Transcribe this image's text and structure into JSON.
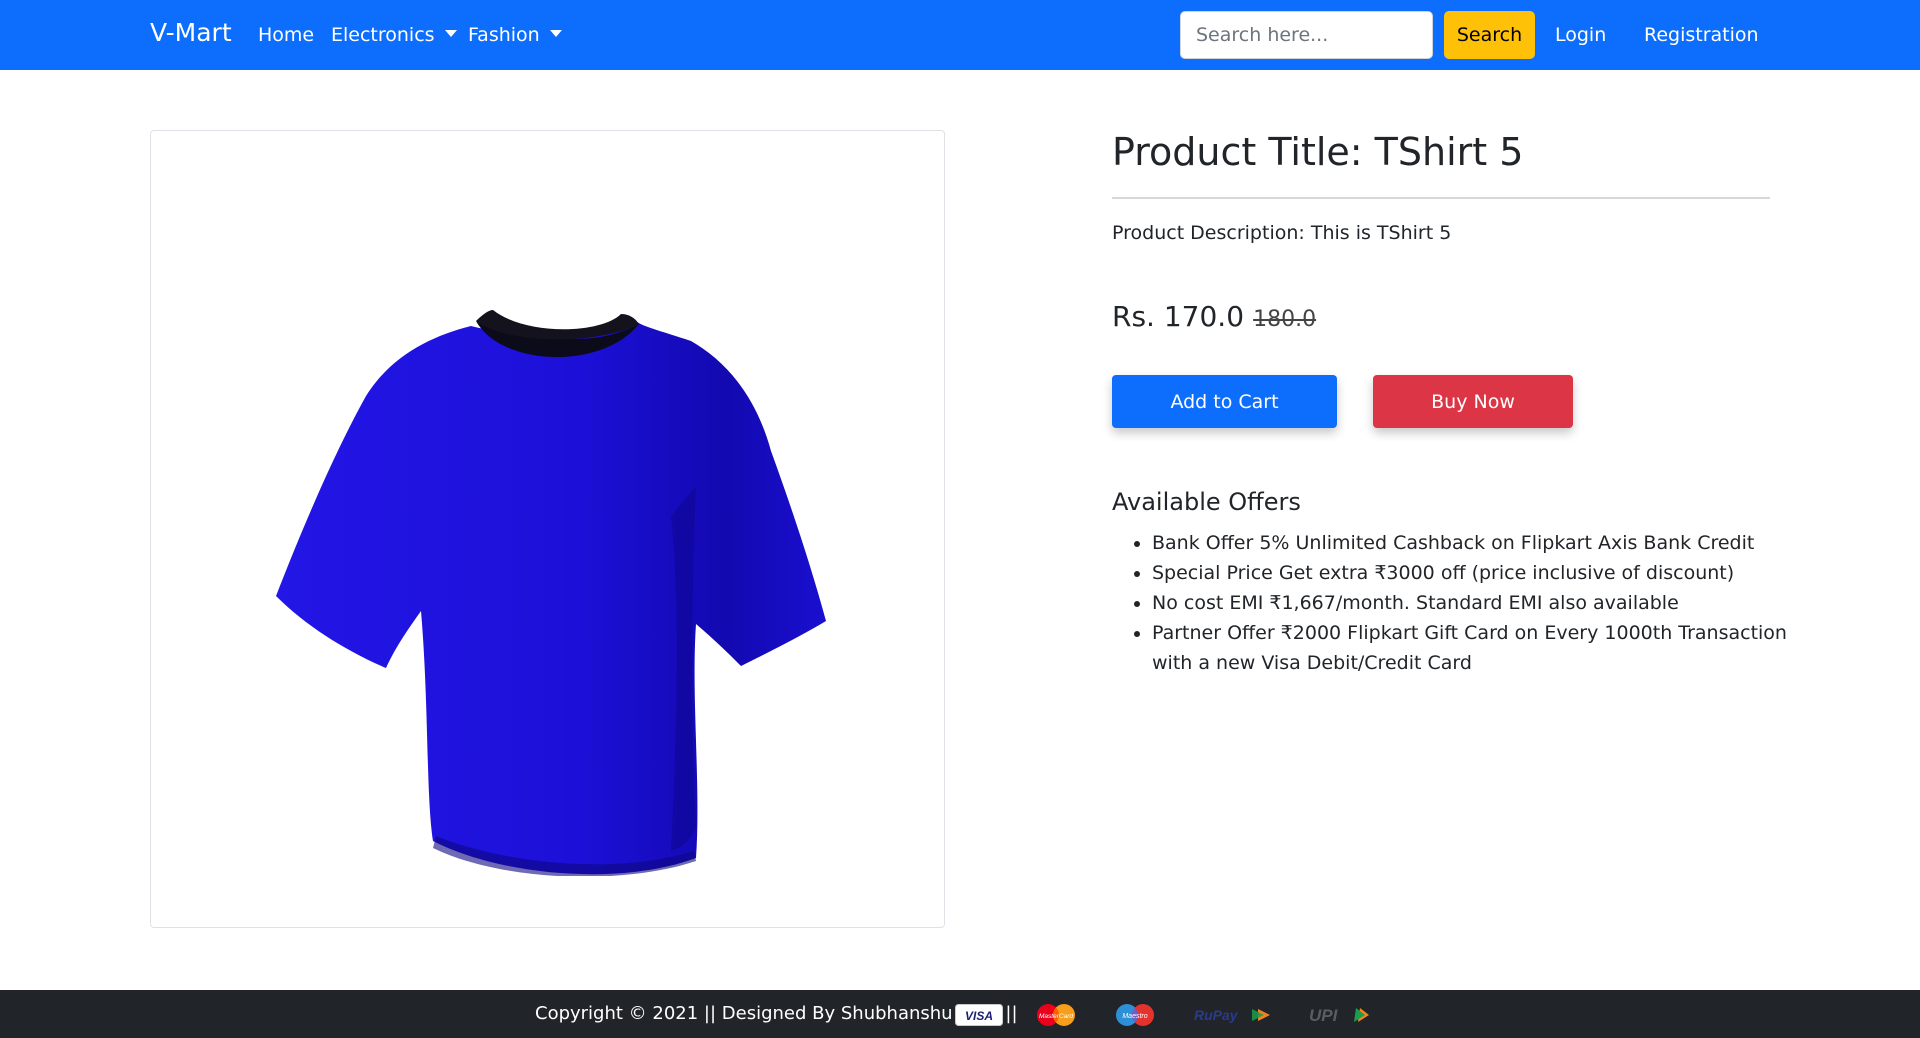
{
  "navbar": {
    "brand": "V-Mart",
    "links": {
      "home": "Home",
      "electronics": "Electronics",
      "fashion": "Fashion"
    },
    "search": {
      "placeholder": "Search here...",
      "value": "",
      "button_label": "Search"
    },
    "login": "Login",
    "registration": "Registration"
  },
  "product": {
    "image_alt": "Blue T-shirt",
    "title": "Product Title: TShirt 5",
    "description": "Product Description: This is TShirt 5",
    "price": "Rs. 170.0",
    "original_price": "180.0",
    "add_to_cart": "Add to Cart",
    "buy_now": "Buy Now"
  },
  "offers": {
    "heading": "Available Offers",
    "items": [
      "Bank Offer 5% Unlimited Cashback on Flipkart Axis Bank Credit",
      "Special Price Get extra ₹3000 off (price inclusive of discount)",
      "No cost EMI ₹1,667/month. Standard EMI also available",
      "Partner Offer ₹2000 Flipkart Gift Card on Every 1000th Transaction with a new Visa Debit/Credit Card"
    ]
  },
  "footer": {
    "copyright": "Copyright © 2021 || Designed By Shubhanshu Arya ||",
    "payment_methods": {
      "visa": "VISA",
      "mastercard": "MasterCard",
      "maestro": "Maestro",
      "rupay": "RuPay",
      "upi": "UPI"
    }
  },
  "colors": {
    "navbar": "#0d6efd",
    "search_button": "#ffc107",
    "add_to_cart": "#0d6efd",
    "buy_now": "#dc3545",
    "footer": "#212529",
    "tshirt": "#1a0fd8"
  }
}
